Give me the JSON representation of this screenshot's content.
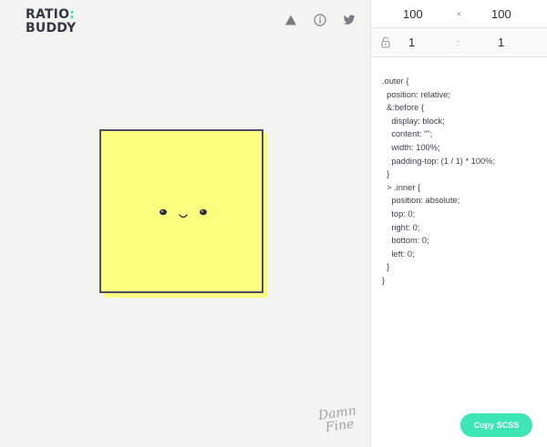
{
  "logo": {
    "line1_prefix": "RATIO",
    "line1_colon": ":",
    "line2": "BUDDY"
  },
  "icons": [
    "triangle-icon",
    "info-icon",
    "twitter-icon"
  ],
  "ratio": {
    "width": "100",
    "times": "×",
    "height": "100",
    "left": "1",
    "colon": ":",
    "right": "1"
  },
  "code_lines": [
    ".outer {",
    "  position: relative;",
    "  &:before {",
    "    display: block;",
    "    content: \"\";",
    "    width: 100%;",
    "    padding-top: (1 / 1) * 100%;",
    "  }",
    "  > .inner {",
    "    position: absolute;",
    "    top: 0;",
    "    right: 0;",
    "    bottom: 0;",
    "    left: 0;",
    "  }",
    "}"
  ],
  "signature": {
    "line1": "Damn",
    "line2": "Fine"
  },
  "copy_button": "Copy SCSS",
  "colors": {
    "accent": "#3ee6b5",
    "box_fill": "#faff80",
    "box_border": "#4d4e63",
    "logo_colon": "#3bd6c0"
  }
}
